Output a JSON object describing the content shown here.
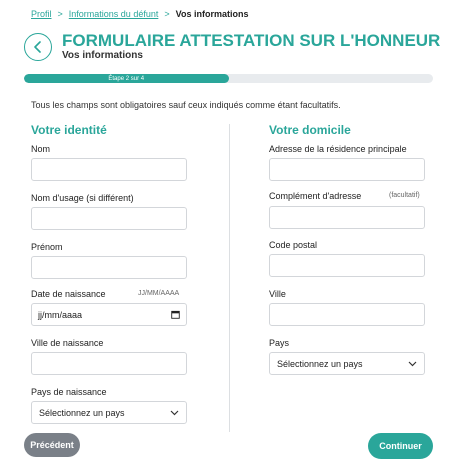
{
  "breadcrumb": {
    "items": [
      "Profil",
      "Informations du défunt"
    ],
    "separator": ">",
    "current": "Vos informations"
  },
  "header": {
    "title": "FORMULAIRE ATTESTATION SUR L'HONNEUR",
    "subtitle": "Vos informations",
    "back_icon": "chevron-left-icon"
  },
  "progress": {
    "label": "Étape 2 sur 4",
    "fraction": 0.5
  },
  "intro": "Tous les champs sont obligatoires sauf ceux indiqués comme étant facultatifs.",
  "identity": {
    "title": "Votre identité",
    "nom_label": "Nom",
    "nom_usage_label": "Nom d'usage (si différent)",
    "prenom_label": "Prénom",
    "date_label": "Date de naissance",
    "date_hint": "JJ/MM/AAAA",
    "date_placeholder": "jj/mm/aaaa",
    "ville_label": "Ville de naissance",
    "pays_label": "Pays de naissance",
    "pays_value": "Sélectionnez un pays"
  },
  "domicile": {
    "title": "Votre domicile",
    "adresse_label": "Adresse de la résidence principale",
    "complement_label": "Complément d'adresse",
    "complement_hint": "(facultatif)",
    "cp_label": "Code postal",
    "ville_label": "Ville",
    "pays_label": "Pays",
    "pays_value": "Sélectionnez un pays"
  },
  "footer": {
    "prev_label": "Précédent",
    "next_label": "Continuer"
  },
  "colors": {
    "accent": "#2aa69a",
    "secondary_button": "#7a8088",
    "border": "#d3d6da"
  }
}
